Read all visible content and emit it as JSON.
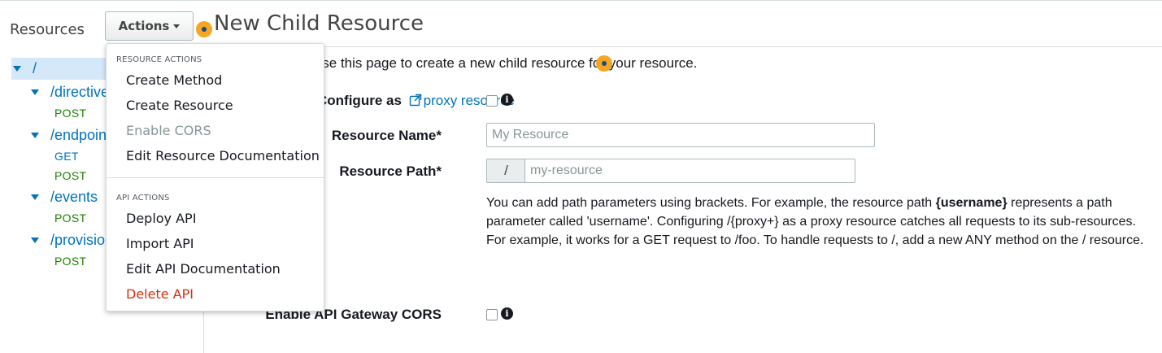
{
  "sidebar": {
    "title": "Resources",
    "tree": [
      {
        "path": "/",
        "methods": []
      },
      {
        "path": "/directives",
        "methods": [
          "POST"
        ]
      },
      {
        "path": "/endpoints",
        "methods": [
          "GET",
          "POST"
        ]
      },
      {
        "path": "/events",
        "methods": [
          "POST"
        ]
      },
      {
        "path": "/provisioning",
        "methods": [
          "POST"
        ]
      }
    ]
  },
  "actions_button": {
    "label": "Actions"
  },
  "menu": {
    "resource_section": "RESOURCE ACTIONS",
    "resource_items": [
      "Create Method",
      "Create Resource",
      "Enable CORS",
      "Edit Resource Documentation"
    ],
    "api_section": "API ACTIONS",
    "api_items": [
      "Deploy API",
      "Import API",
      "Edit API Documentation",
      "Delete API"
    ]
  },
  "page": {
    "title": "New Child Resource",
    "intro": "Use this page to create a new child resource for your resource."
  },
  "form": {
    "proxy_label_prefix": "Configure as",
    "proxy_label_link": "proxy resource",
    "resource_name_label": "Resource Name*",
    "resource_name_placeholder": "My Resource",
    "resource_path_label": "Resource Path*",
    "resource_path_prefix": "/",
    "resource_path_placeholder": "my-resource",
    "help_part1": "You can add path parameters using brackets. For example, the resource path ",
    "help_bold": "{username}",
    "help_part2": " represents a path parameter called 'username'. Configuring /{proxy+} as a proxy resource catches all requests to its sub-resources. For example, it works for a GET request to /foo. To handle requests to /, add a new ANY method on the / resource.",
    "cors_label": "Enable API Gateway CORS"
  },
  "colors": {
    "link": "#0073bb",
    "method": "#1d8102",
    "get": "#0073bb",
    "danger": "#d13212",
    "hotspot": "#f5a623",
    "selected_row": "#d5e8f9"
  },
  "icons": [
    "external-link-icon",
    "info-icon",
    "caret-down-icon"
  ]
}
